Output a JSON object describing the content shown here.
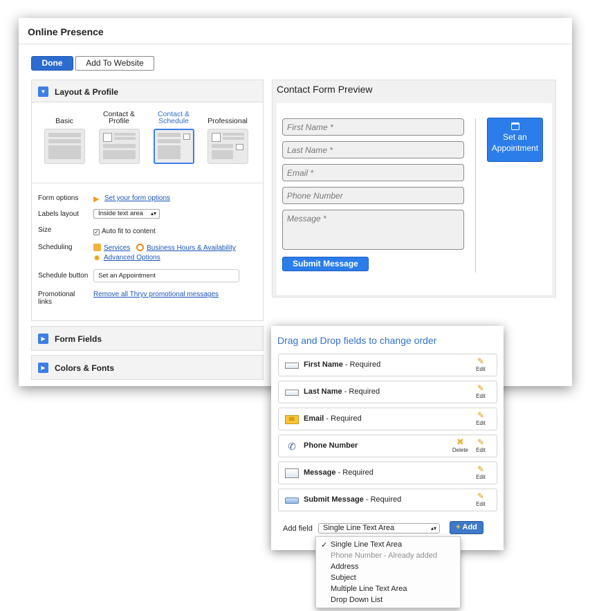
{
  "window": {
    "title": "Online Presence"
  },
  "toolbar": {
    "done_label": "Done",
    "add_to_website_label": "Add To Website"
  },
  "layout_profile": {
    "heading": "Layout & Profile",
    "layouts": [
      {
        "name_line1": "",
        "name_line2": "Basic",
        "selected": false
      },
      {
        "name_line1": "Contact &",
        "name_line2": "Profile",
        "selected": false
      },
      {
        "name_line1": "Contact &",
        "name_line2": "Schedule",
        "selected": true
      },
      {
        "name_line1": "",
        "name_line2": "Professional",
        "selected": false
      }
    ],
    "form_options_label": "Form options",
    "form_options_link": "Set your form options",
    "labels_layout_label": "Labels layout",
    "labels_layout_value": "Inside text area",
    "size_label": "Size",
    "size_value": "Auto fit to content",
    "scheduling_label": "Scheduling",
    "scheduling_services": "Services",
    "scheduling_hours": "Business Hours & Availability",
    "scheduling_advanced": "Advanced Options",
    "schedule_button_label": "Schedule button",
    "schedule_button_value": "Set an Appointment",
    "promo_label_line1": "Promotional",
    "promo_label_line2": "links",
    "promo_link": "Remove all Thryv promotional messages"
  },
  "form_fields_section": {
    "heading": "Form Fields"
  },
  "colors_fonts_section": {
    "heading": "Colors & Fonts"
  },
  "preview": {
    "title": "Contact Form Preview",
    "fields": [
      {
        "placeholder": "First Name *"
      },
      {
        "placeholder": "Last Name *"
      },
      {
        "placeholder": "Email *"
      },
      {
        "placeholder": "Phone Number"
      },
      {
        "placeholder": "Message *"
      }
    ],
    "submit_label": "Submit Message",
    "appointment_line1": "Set an",
    "appointment_line2": "Appointment"
  },
  "field_order": {
    "title": "Drag and Drop fields to change order",
    "rows": [
      {
        "name": "First Name",
        "suffix": " - Required",
        "icon": "text-field-icon",
        "edit": "Edit"
      },
      {
        "name": "Last Name",
        "suffix": " - Required",
        "icon": "text-field-icon",
        "edit": "Edit"
      },
      {
        "name": "Email",
        "suffix": " - Required",
        "icon": "envelope-icon",
        "edit": "Edit"
      },
      {
        "name": "Phone Number",
        "suffix": "",
        "icon": "phone-icon",
        "edit": "Edit",
        "delete": "Delete"
      },
      {
        "name": "Message",
        "suffix": " - Required",
        "icon": "textarea-icon",
        "edit": "Edit"
      },
      {
        "name": "Submit Message",
        "suffix": " - Required",
        "icon": "button-icon",
        "edit": "Edit"
      }
    ],
    "add_field_label": "Add field",
    "add_field_value": "Single Line Text Area",
    "add_button": "Add"
  },
  "dropdown": {
    "options": [
      {
        "label": "Single Line Text Area",
        "checked": true,
        "disabled": false
      },
      {
        "label": "Phone Number - Already added",
        "checked": false,
        "disabled": true
      },
      {
        "label": "Address",
        "checked": false,
        "disabled": false
      },
      {
        "label": "Subject",
        "checked": false,
        "disabled": false
      },
      {
        "label": "Multiple Line Text Area",
        "checked": false,
        "disabled": false
      },
      {
        "label": "Drop Down List",
        "checked": false,
        "disabled": false
      }
    ],
    "check_mark": "✓"
  },
  "colors": {
    "accent": "#2d6ccf",
    "button_blue": "#2b7de9",
    "link": "#1a55b8",
    "popup_title": "#3571c8"
  }
}
